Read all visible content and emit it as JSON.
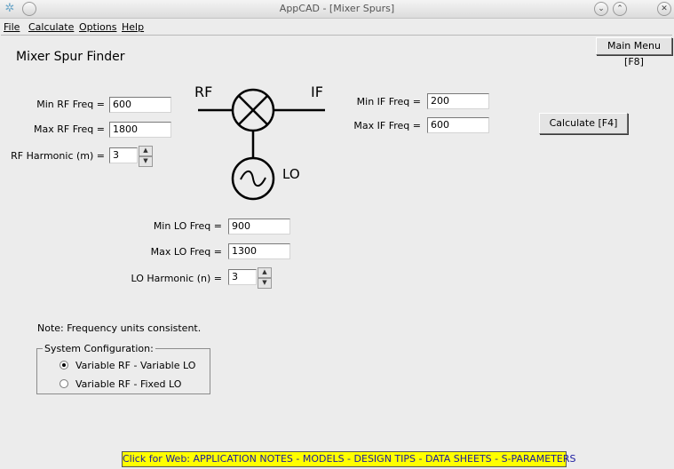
{
  "window": {
    "title": "AppCAD - [Mixer Spurs]"
  },
  "menu": {
    "file": "File",
    "calculate": "Calculate",
    "options": "Options",
    "help": "Help"
  },
  "main_menu_button": "Main Menu [F8]",
  "heading": "Mixer Spur Finder",
  "rf": {
    "min_label": "Min RF Freq =",
    "min_value": "600",
    "max_label": "Max RF Freq =",
    "max_value": "1800",
    "harmonic_label": "RF Harmonic (m) =",
    "harmonic_value": "3"
  },
  "if": {
    "min_label": "Min IF Freq =",
    "min_value": "200",
    "max_label": "Max IF Freq =",
    "max_value": "600"
  },
  "lo": {
    "min_label": "Min LO Freq =",
    "min_value": "900",
    "max_label": "Max LO Freq =",
    "max_value": "1300",
    "harmonic_label": "LO Harmonic (n) =",
    "harmonic_value": "3"
  },
  "diagram": {
    "rf": "RF",
    "if": "IF",
    "lo": "LO"
  },
  "calculate_button": "Calculate  [F4]",
  "note": "Note: Frequency units consistent.",
  "system_config": {
    "legend": "System Configuration:",
    "options": [
      {
        "label": "Variable RF - Variable LO",
        "selected": true
      },
      {
        "label": "Variable RF - Fixed LO",
        "selected": false
      }
    ]
  },
  "footer_link": "Click for Web: APPLICATION NOTES - MODELS - DESIGN TIPS - DATA SHEETS - S-PARAMETERS",
  "colors": {
    "footer_bg": "#ffff00",
    "footer_text": "#1a1aa0",
    "window_bg": "#ececec"
  }
}
